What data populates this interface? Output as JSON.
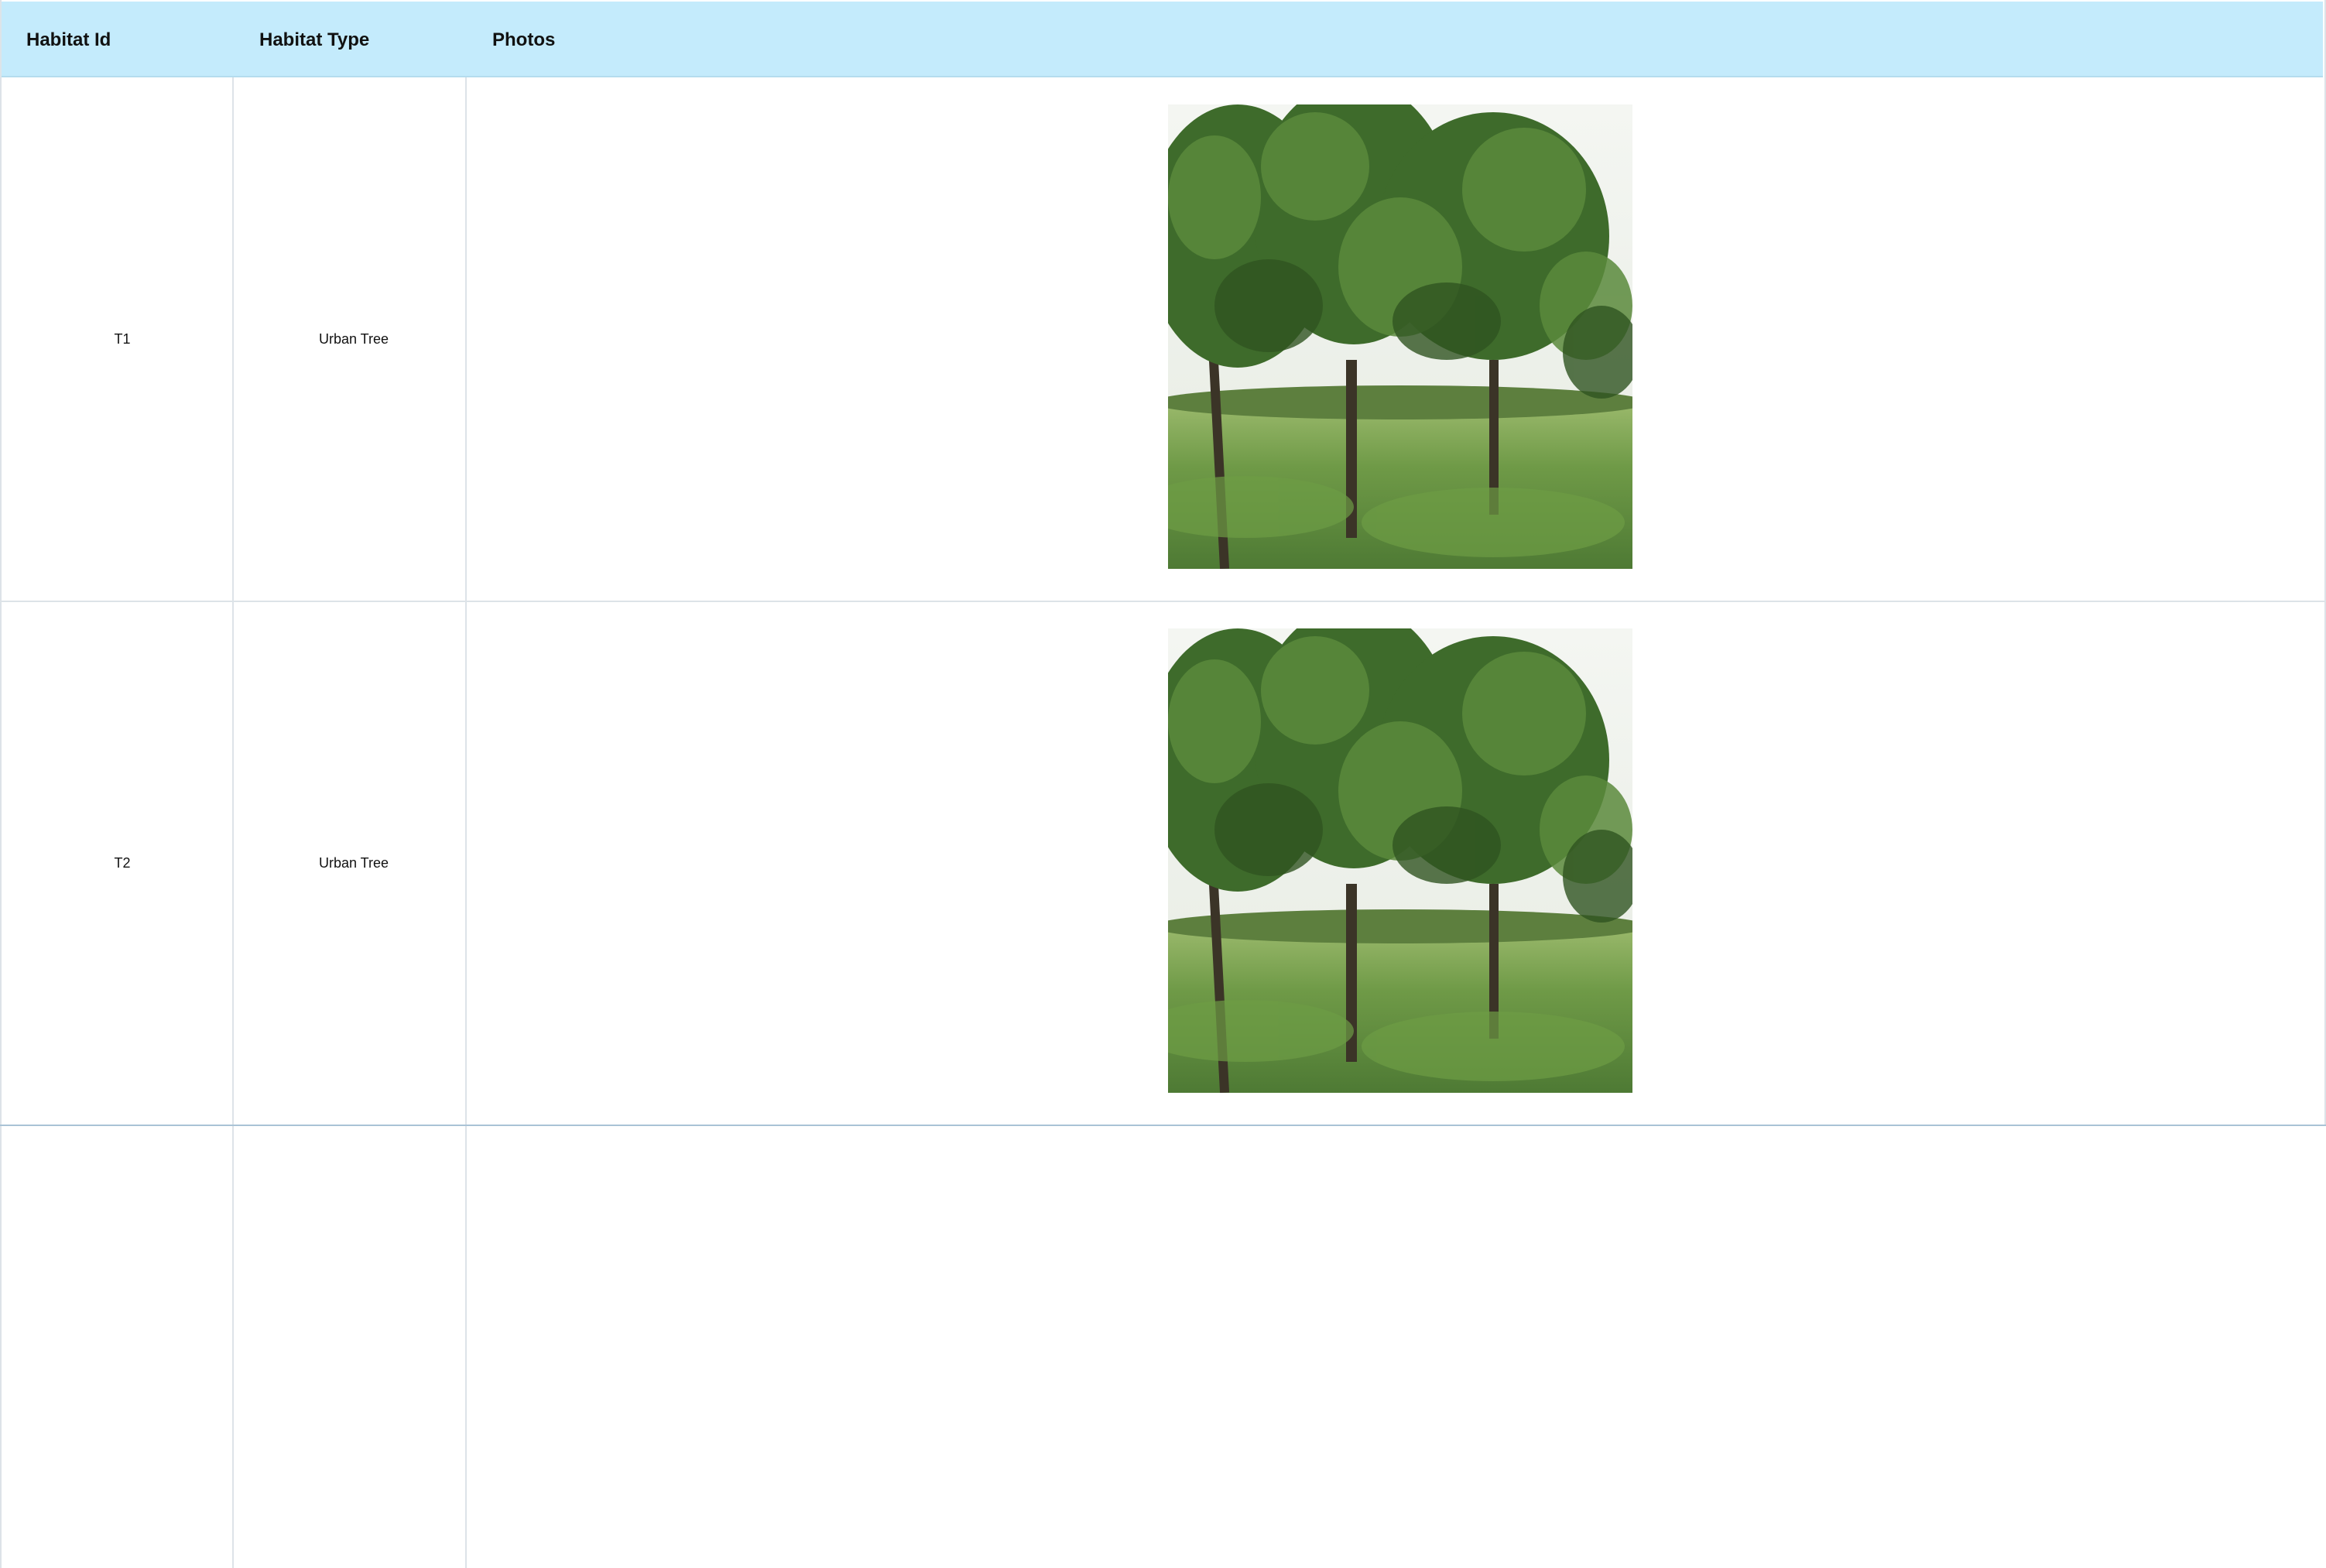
{
  "table": {
    "columns": [
      "Habitat Id",
      "Habitat Type",
      "Photos"
    ],
    "rows": [
      {
        "habitat_id": "T1",
        "habitat_type": "Urban Tree",
        "photo": "tree-photo"
      },
      {
        "habitat_id": "T2",
        "habitat_type": "Urban Tree",
        "photo": "tree-photo"
      }
    ]
  },
  "colors": {
    "header_background": "#c4ebfc",
    "grid_line": "#dde3e8"
  }
}
